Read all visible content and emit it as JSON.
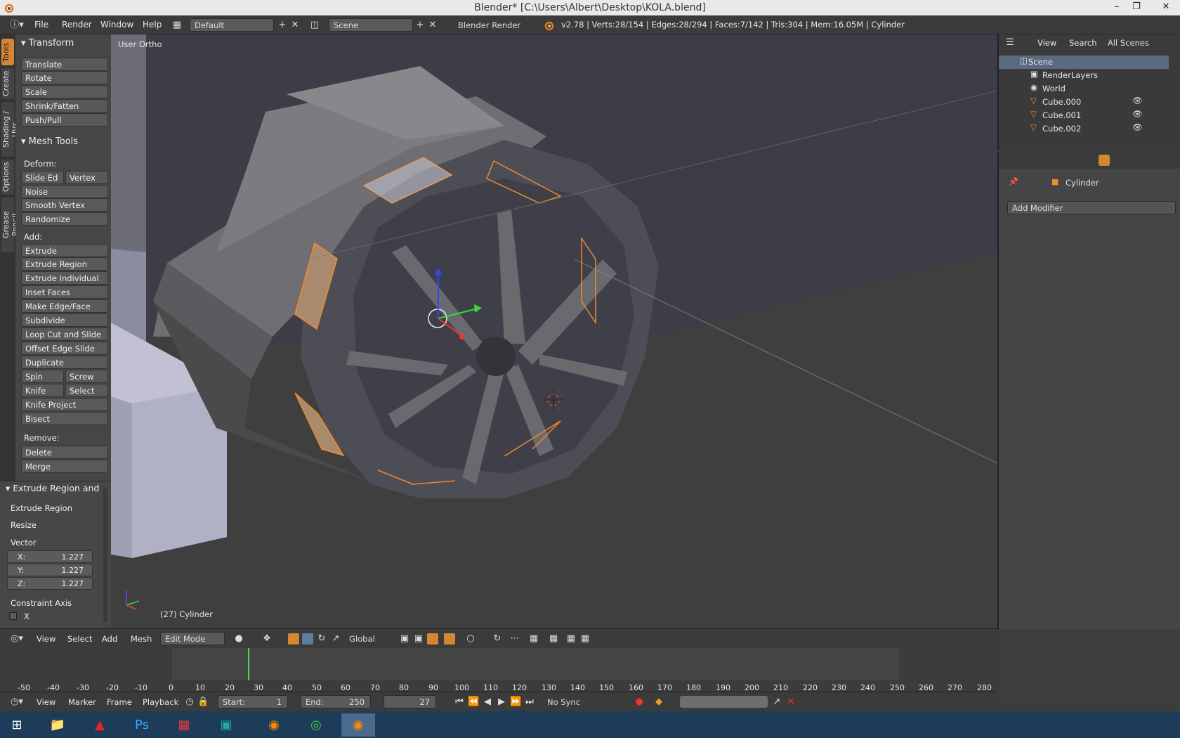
{
  "window": {
    "title": "Blender* [C:\\Users\\Albert\\Desktop\\KOLA.blend]"
  },
  "info": {
    "menus": [
      "File",
      "Render",
      "Window",
      "Help"
    ],
    "layout": "Default",
    "scene": "Scene",
    "engine": "Blender Render",
    "stats": "v2.78 | Verts:28/154 | Edges:28/294 | Faces:7/142 | Tris:304 | Mem:16.05M | Cylinder"
  },
  "tabs": [
    "Tools",
    "Create",
    "Shading / UVs",
    "Options",
    "Grease Pencil"
  ],
  "toolshelf": {
    "transform_title": "Transform",
    "transform": [
      "Translate",
      "Rotate",
      "Scale",
      "Shrink/Fatten",
      "Push/Pull"
    ],
    "meshtools_title": "Mesh Tools",
    "deform_label": "Deform:",
    "slide_edge": "Slide Ed",
    "vertex": "Vertex",
    "noise": "Noise",
    "smooth_vertex": "Smooth Vertex",
    "randomize": "Randomize",
    "add_label": "Add:",
    "extrude": "Extrude",
    "add_items": [
      "Extrude Region",
      "Extrude Individual",
      "Inset Faces",
      "Make Edge/Face",
      "Subdivide",
      "Loop Cut and Slide",
      "Offset Edge Slide",
      "Duplicate"
    ],
    "spin": "Spin",
    "screw": "Screw",
    "knife": "Knife",
    "select": "Select",
    "knife_project": "Knife Project",
    "bisect": "Bisect",
    "remove_label": "Remove:",
    "delete": "Delete",
    "merge": "Merge"
  },
  "operator": {
    "title": "Extrude Region and",
    "name": "Extrude Region",
    "resize": "Resize",
    "vector_label": "Vector",
    "x_label": "X:",
    "x": "1.227",
    "y_label": "Y:",
    "y": "1.227",
    "z_label": "Z:",
    "z": "1.227",
    "constraint_label": "Constraint Axis",
    "cx": "X"
  },
  "viewport": {
    "view_label": "User Ortho",
    "object_label": "(27) Cylinder"
  },
  "outliner": {
    "menus": [
      "View",
      "Search"
    ],
    "scenes": "All Scenes",
    "rows": [
      "Scene",
      "RenderLayers",
      "World",
      "Cube.000",
      "Cube.001",
      "Cube.002"
    ]
  },
  "properties": {
    "object": "Cylinder",
    "add_modifier": "Add Modifier"
  },
  "viewport_header": {
    "menus": [
      "View",
      "Select",
      "Add",
      "Mesh"
    ],
    "mode": "Edit Mode",
    "orientation": "Global"
  },
  "timeline": {
    "ticks": [
      "-50",
      "-40",
      "-30",
      "-20",
      "-10",
      "0",
      "10",
      "20",
      "30",
      "40",
      "50",
      "60",
      "70",
      "80",
      "90",
      "100",
      "110",
      "120",
      "130",
      "140",
      "150",
      "160",
      "170",
      "180",
      "190",
      "200",
      "210",
      "220",
      "230",
      "240",
      "250",
      "260",
      "270",
      "280"
    ],
    "current_frame": 27
  },
  "timeline_header": {
    "menus": [
      "View",
      "Marker",
      "Frame",
      "Playback"
    ],
    "start_label": "Start:",
    "start": "1",
    "end_label": "End:",
    "end": "250",
    "frame": "27",
    "sync": "No Sync"
  },
  "colors": {
    "accent": "#d48635",
    "selected": "#f08a2c",
    "viewport_bg": "#3f3f48"
  }
}
